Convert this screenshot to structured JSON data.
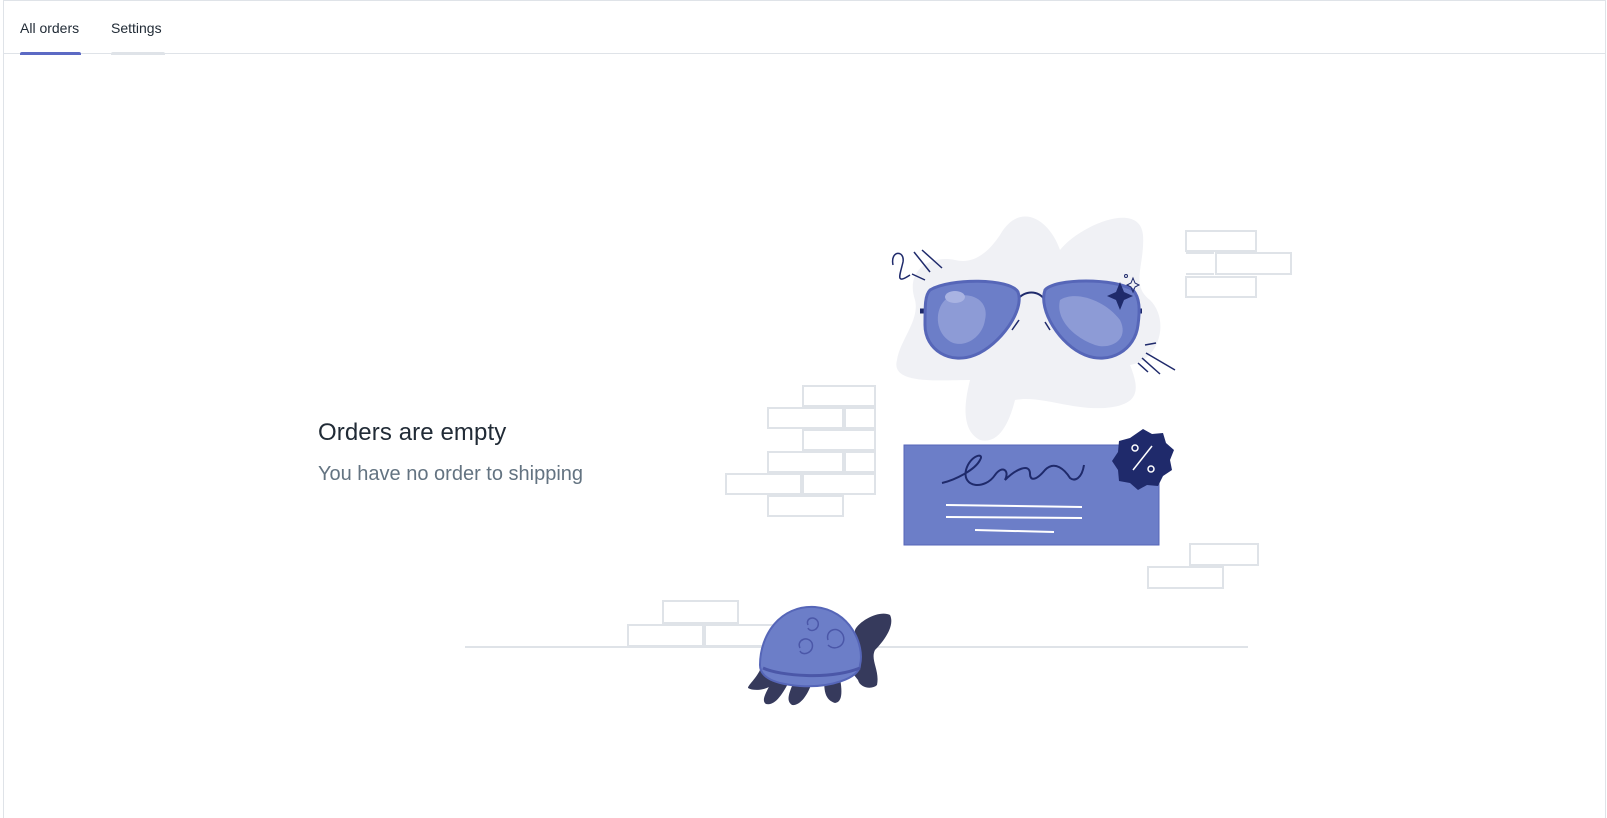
{
  "tabs": [
    {
      "label": "All orders",
      "active": true
    },
    {
      "label": "Settings",
      "active": false
    }
  ],
  "empty_state": {
    "heading": "Orders are empty",
    "message": "You have no order to shipping"
  },
  "colors": {
    "accent": "#5c6ac4",
    "text_primary": "#212b36",
    "text_secondary": "#637381",
    "border": "#dfe3e8",
    "illustration_blue": "#6c7ec8",
    "illustration_dark": "#1f2a6b"
  },
  "illustration_icons": [
    "sunglasses-icon",
    "signature-card-icon",
    "discount-badge-icon",
    "turtle-icon",
    "brick-wall-icon"
  ]
}
